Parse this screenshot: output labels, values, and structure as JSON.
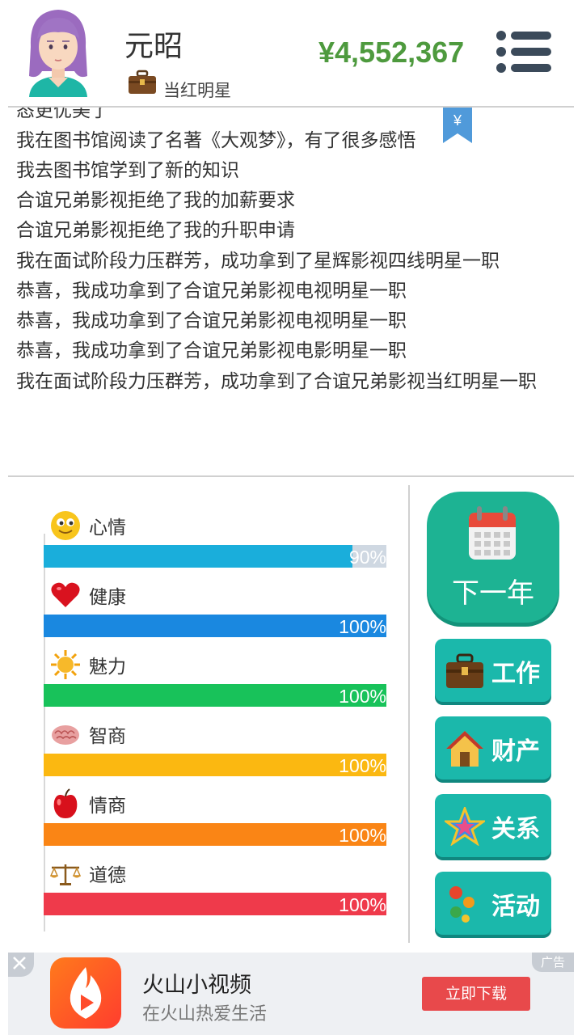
{
  "header": {
    "player_name": "元昭",
    "job_title": "当红明星",
    "money": "¥4,552,367",
    "yen_symbol": "¥"
  },
  "log": {
    "lines": [
      "态更优美了",
      "我在图书馆阅读了名著《大观梦》，有了很多感悟",
      "我去图书馆学到了新的知识",
      "合谊兄弟影视拒绝了我的加薪要求",
      "合谊兄弟影视拒绝了我的升职申请",
      "我在面试阶段力压群芳，成功拿到了星辉影视四线明星一职",
      "恭喜，我成功拿到了合谊兄弟影视电视明星一职",
      "恭喜，我成功拿到了合谊兄弟影视电视明星一职",
      "恭喜，我成功拿到了合谊兄弟影视电影明星一职",
      "我在面试阶段力压群芳，成功拿到了合谊兄弟影视当红明星一职"
    ]
  },
  "stats": [
    {
      "label": "心情",
      "value": 90,
      "display": "90%",
      "color": "#1aaedb",
      "icon": "smiley-icon"
    },
    {
      "label": "健康",
      "value": 100,
      "display": "100%",
      "color": "#1a88e0",
      "icon": "heart-icon"
    },
    {
      "label": "魅力",
      "value": 100,
      "display": "100%",
      "color": "#18c25a",
      "icon": "sun-icon"
    },
    {
      "label": "智商",
      "value": 100,
      "display": "100%",
      "color": "#fbb811",
      "icon": "brain-icon"
    },
    {
      "label": "情商",
      "value": 100,
      "display": "100%",
      "color": "#fa8515",
      "icon": "apple-icon"
    },
    {
      "label": "道德",
      "value": 100,
      "display": "100%",
      "color": "#ef3a4b",
      "icon": "scales-icon"
    }
  ],
  "actions": {
    "next_year": "下一年",
    "work": "工作",
    "property": "财产",
    "relations": "关系",
    "activities": "活动"
  },
  "ad": {
    "tag": "广告",
    "title": "火山小视频",
    "subtitle": "在火山热爱生活",
    "download": "立即下载"
  }
}
